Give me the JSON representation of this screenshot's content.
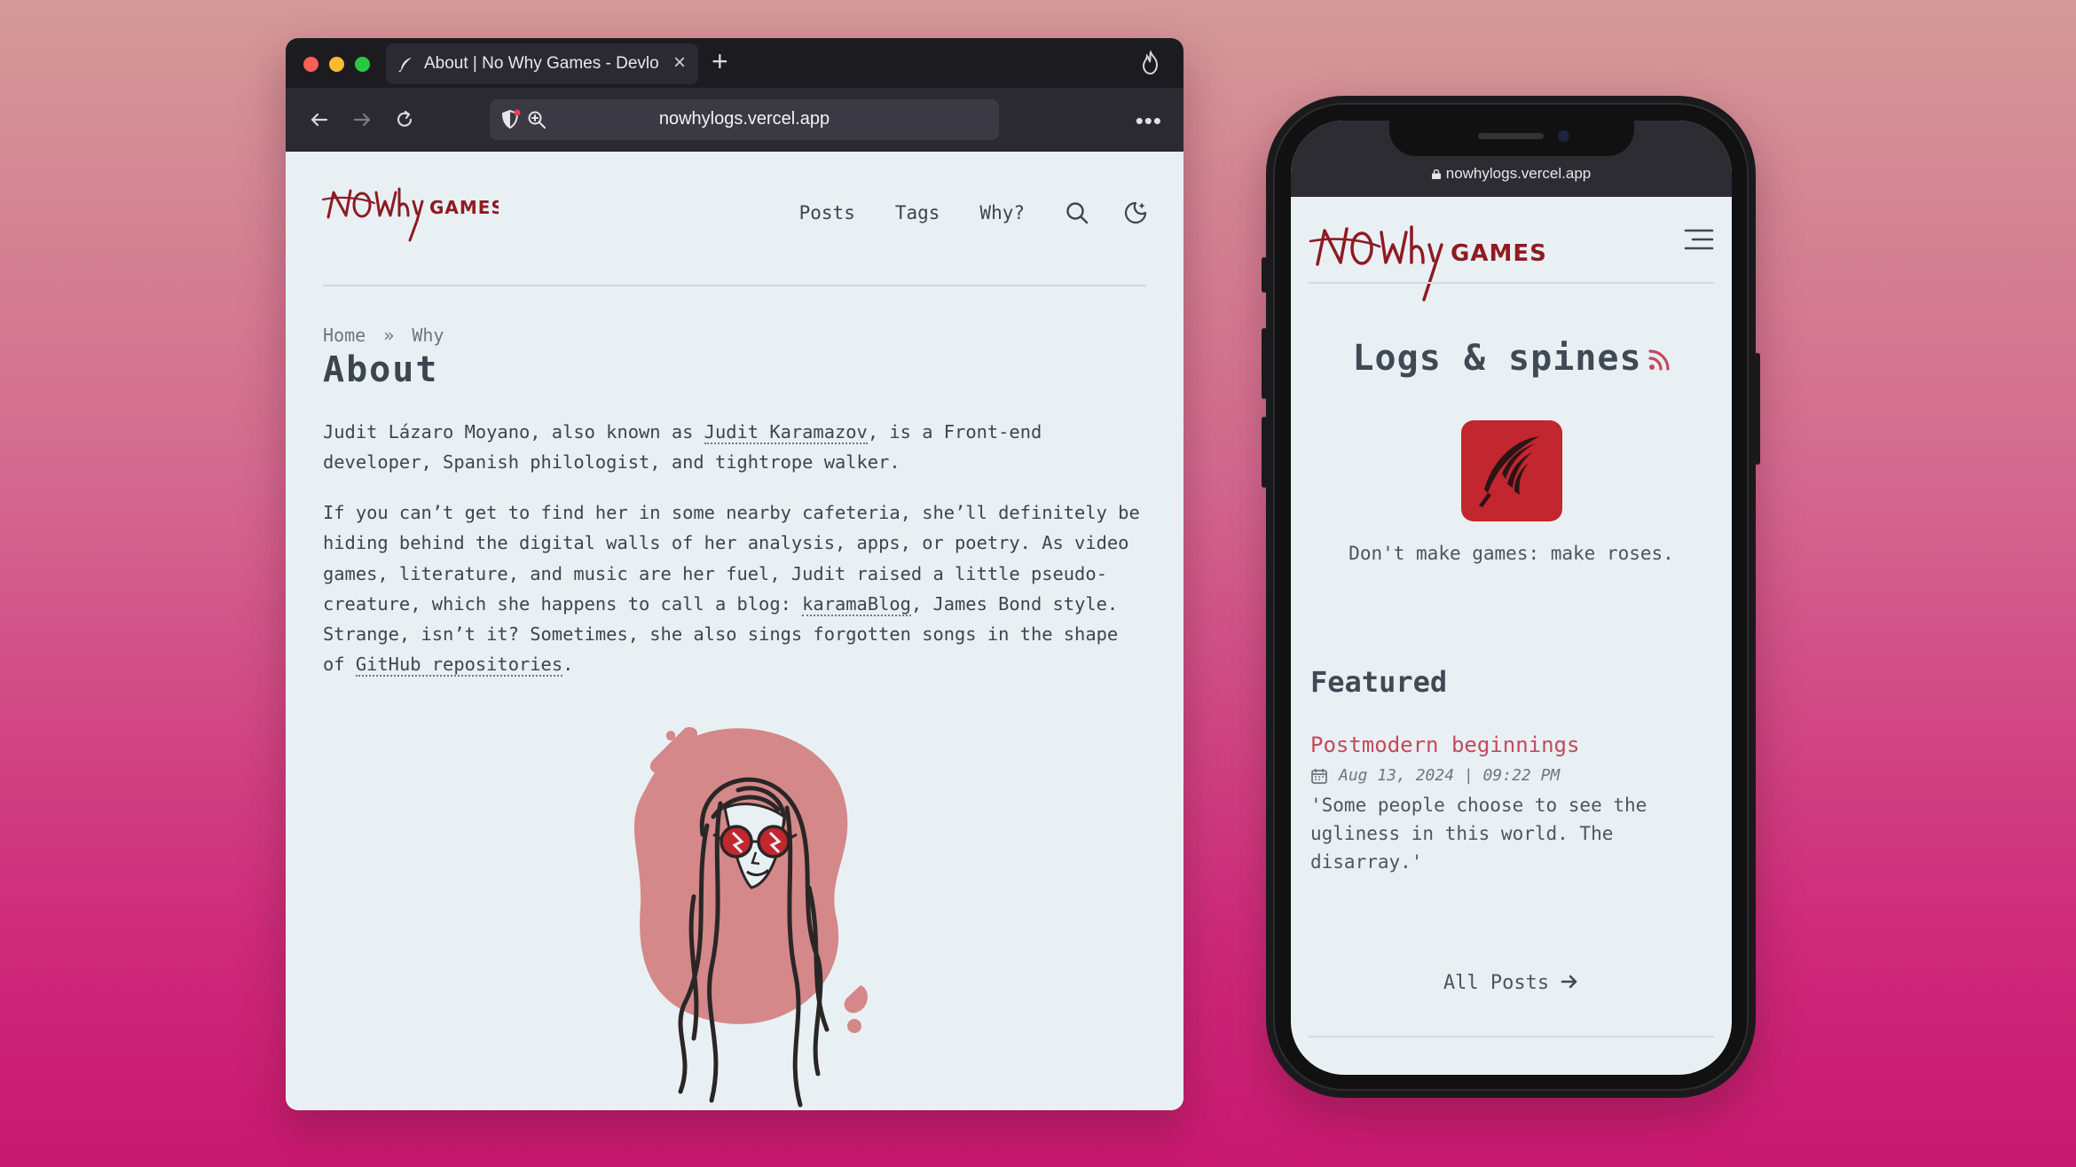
{
  "browser": {
    "tab_title": "About | No Why Games - Devlo",
    "url": "nowhylogs.vercel.app"
  },
  "desktop_site": {
    "logo_alt": "NO Why GAMES",
    "nav": {
      "posts": "Posts",
      "tags": "Tags",
      "why": "Why?"
    },
    "breadcrumb": {
      "home": "Home",
      "sep": "»",
      "current": "Why"
    },
    "heading": "About",
    "p1": {
      "a": "Judit Lázaro Moyano, also known as ",
      "link": "Judit Karamazov",
      "b": ", is a Front-end developer, Spanish philologist, and tightrope walker."
    },
    "p2": {
      "a": "If you can’t get to find her in some nearby cafeteria, she’ll definitely be hiding behind the digital walls of her analysis, apps, or poetry. As video games, literature, and music are her fuel, Judit raised a little pseudo-creature, which she happens to call a blog: ",
      "link1": "karamaBlog",
      "b": ", James Bond style. Strange, isn’t it? Sometimes, she also sings forgotten songs in the shape of ",
      "link2": "GitHub repositories",
      "c": "."
    }
  },
  "mobile_site": {
    "url": "nowhylogs.vercel.app",
    "title": "Logs & spines",
    "tagline": "Don't make games: make roses.",
    "featured_heading": "Featured",
    "featured_post": {
      "title": "Postmodern beginnings",
      "date": "Aug 13, 2024 | 09:22 PM",
      "excerpt": "'Some people choose to see the ugliness in this world. The disarray.'"
    },
    "all_posts": "All Posts"
  },
  "colors": {
    "accent_red": "#c2262e",
    "link_pink": "#c24b5c",
    "page_bg": "#e9f0f4",
    "text": "#3b4650"
  },
  "icons": {
    "search": "search-icon",
    "theme": "moon-icon",
    "rss": "rss-icon",
    "menu": "hamburger-menu-icon",
    "calendar": "calendar-icon",
    "arrow": "arrow-right-icon"
  }
}
